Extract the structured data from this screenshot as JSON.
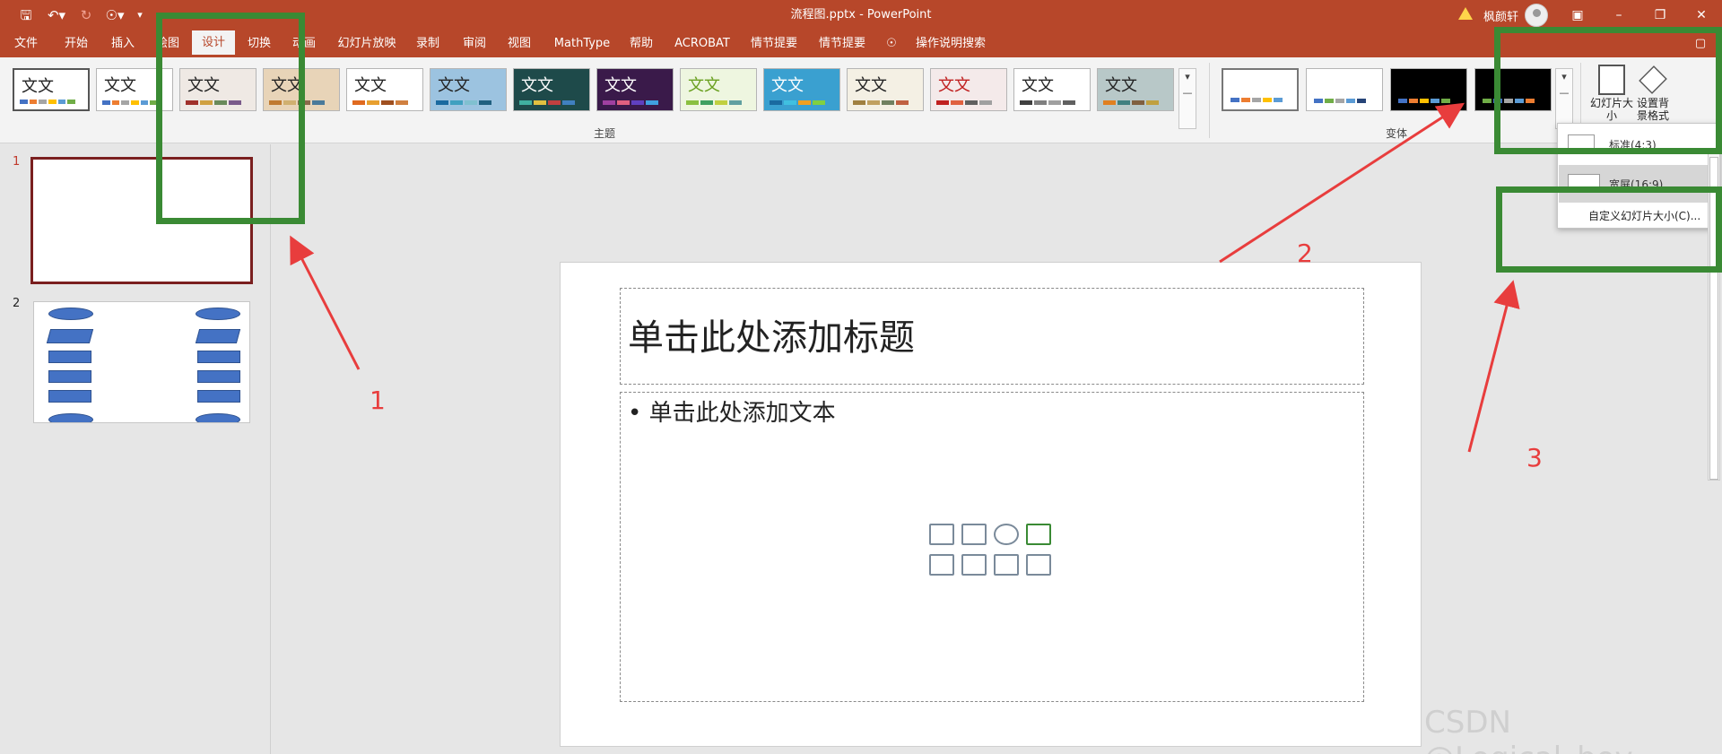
{
  "window": {
    "file_title": "流程图.pptx - PowerPoint",
    "user_name": "枫颜轩"
  },
  "menu": {
    "tabs": [
      {
        "label": "文件"
      },
      {
        "label": "开始"
      },
      {
        "label": "插入"
      },
      {
        "label": "绘图"
      },
      {
        "label": "设计",
        "active": true
      },
      {
        "label": "切换"
      },
      {
        "label": "动画"
      },
      {
        "label": "幻灯片放映"
      },
      {
        "label": "录制"
      },
      {
        "label": "审阅"
      },
      {
        "label": "视图"
      },
      {
        "label": "MathType"
      },
      {
        "label": "帮助"
      },
      {
        "label": "ACROBAT"
      },
      {
        "label": "情节提要"
      },
      {
        "label": "情节提要"
      }
    ],
    "search_label": "操作说明搜索"
  },
  "ribbon": {
    "theme_sample_text": "文文",
    "themes_group_label": "主题",
    "variants_group_label": "变体",
    "slide_size_label": "幻灯片大小",
    "format_bg_label": "设置背景格式"
  },
  "dropdown": {
    "standard_label": "标准(4:3)",
    "widescreen_label": "宽屏(16:9)",
    "custom_label": "自定义幻灯片大小(C)..."
  },
  "thumbnails": {
    "slide1_number": "1",
    "slide2_number": "2"
  },
  "slide": {
    "title_placeholder": "单击此处添加标题",
    "body_placeholder": "• 单击此处添加文本"
  },
  "annotations": {
    "label1": "1",
    "label2": "2",
    "label3": "3",
    "watermark": "CSDN @Logical_boy"
  },
  "colors": {
    "accent": "#b7472a",
    "highlight_box": "#3a8a34",
    "arrow": "#e83d3d"
  }
}
